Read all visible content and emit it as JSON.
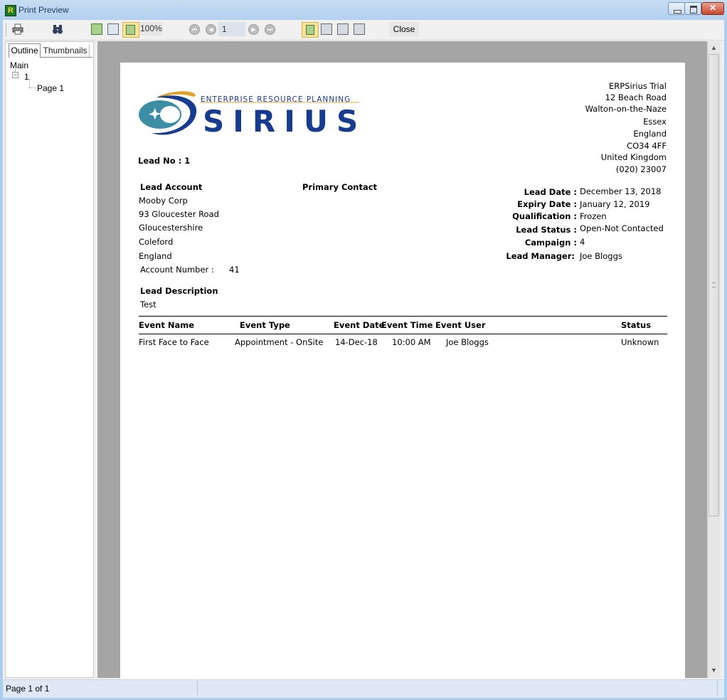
{
  "window": {
    "title": "Print Preview",
    "icon": "app-icon",
    "icon_letter": "R"
  },
  "toolbar": {
    "zoom": "100%",
    "page_number": "1",
    "close_label": "Close",
    "icons": [
      "print-icon",
      "find-icon",
      "single-page-icon",
      "page-setup-icon",
      "zoom-icon",
      "first-page-icon",
      "prev-page-icon",
      "next-page-icon",
      "last-page-icon",
      "layout-single-icon",
      "layout-continuous-icon",
      "layout-facing-icon",
      "layout-multi-icon"
    ]
  },
  "left_panel": {
    "tabs": [
      {
        "label": "Outline"
      },
      {
        "label": "Thumbnails"
      }
    ],
    "tree": {
      "root": "Main",
      "node": "1",
      "leaf": "Page 1"
    }
  },
  "report": {
    "logo": {
      "tagline": "ENTERPRISE RESOURCE PLANNING",
      "word": "SIRIUS"
    },
    "company_address": [
      "ERPSirius Trial",
      "12 Beach Road",
      "Walton-on-the-Naze",
      "Essex",
      "England",
      "CO34 4FF",
      "United Kingdom",
      "(020) 23007"
    ],
    "lead_no": "Lead No : 1",
    "lead_account_label": "Lead Account",
    "account_lines": [
      "Mooby Corp",
      "93 Gloucester Road",
      "Gloucestershire",
      "Coleford",
      "England"
    ],
    "account_number_label": "Account Number :",
    "account_number": "41",
    "primary_contact_label": "Primary Contact",
    "details": [
      {
        "label": "Lead Date :",
        "value": "December 13, 2018"
      },
      {
        "label": "Expiry Date :",
        "value": "January 12, 2019"
      },
      {
        "label": "Qualification :",
        "value": "Frozen"
      },
      {
        "label": "Lead Status :",
        "value": "Open-Not Contacted"
      },
      {
        "label": "Campaign :",
        "value": "4"
      },
      {
        "label": "Lead Manager:",
        "value": "Joe Bloggs"
      }
    ],
    "lead_description_label": "Lead Description",
    "lead_description": "Test",
    "events_table": {
      "headers": [
        "Event Name",
        "Event Type",
        "Event Date",
        "Event Time",
        "Event User",
        "Status"
      ],
      "rows": [
        [
          "First Face to Face",
          "Appointment - OnSite",
          "14-Dec-18",
          "10:00 AM",
          "Joe Bloggs",
          "Unknown"
        ]
      ]
    }
  },
  "status_bar": {
    "text": "Page 1 of 1"
  },
  "colors": {
    "logo_blue": "#173c8f",
    "logo_teal": "#3c8ea5",
    "logo_gold": "#e0a32a",
    "preview_bg": "#a5a5a5"
  }
}
